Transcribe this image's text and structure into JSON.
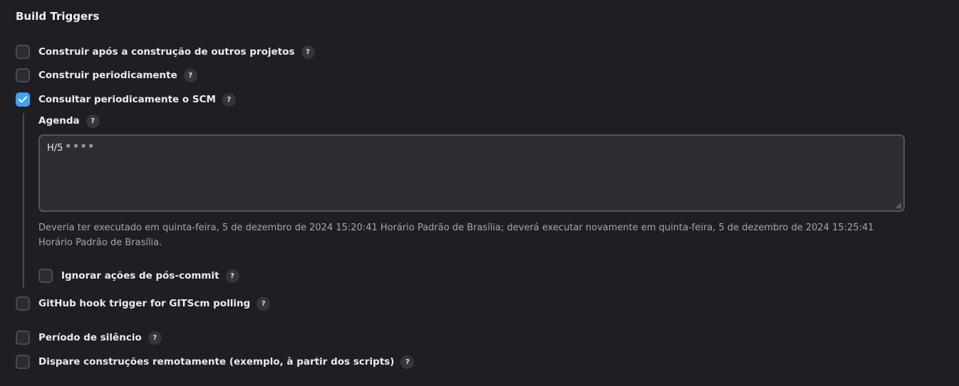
{
  "section": {
    "title": "Build Triggers"
  },
  "triggers": {
    "build_after_other": {
      "label": "Construir após a construção de outros projetos",
      "checked": false
    },
    "build_periodically": {
      "label": "Construir periodicamente",
      "checked": false
    },
    "poll_scm": {
      "label": "Consultar periodicamente o SCM",
      "checked": true
    },
    "github_hook": {
      "label": "GitHub hook trigger for GITScm polling",
      "checked": false
    },
    "quiet_period": {
      "label": "Período de silêncio",
      "checked": false
    },
    "remote_trigger": {
      "label": "Dispare construções remotamente (exemplo, à partir dos scripts)",
      "checked": false
    }
  },
  "poll_scm_options": {
    "schedule_label": "Agenda",
    "schedule_value": "H/5 * * * *",
    "schedule_hint": "Deveria ter executado em quinta-feira, 5 de dezembro de 2024 15:20:41 Horário Padrão de Brasília; deverá executar novamente em quinta-feira, 5 de dezembro de 2024 15:25:41 Horário Padrão de Brasília.",
    "ignore_post_commit": {
      "label": "Ignorar ações de pós-commit",
      "checked": false
    }
  },
  "help": {
    "symbol": "?"
  },
  "colors": {
    "background": "#1f1f23",
    "checkbox_checked": "#3ea2f2",
    "hint_text": "#a6a6ae"
  },
  "icons": {
    "checkmark": "check-icon",
    "help": "help-icon",
    "resize": "resize-handle-icon"
  }
}
